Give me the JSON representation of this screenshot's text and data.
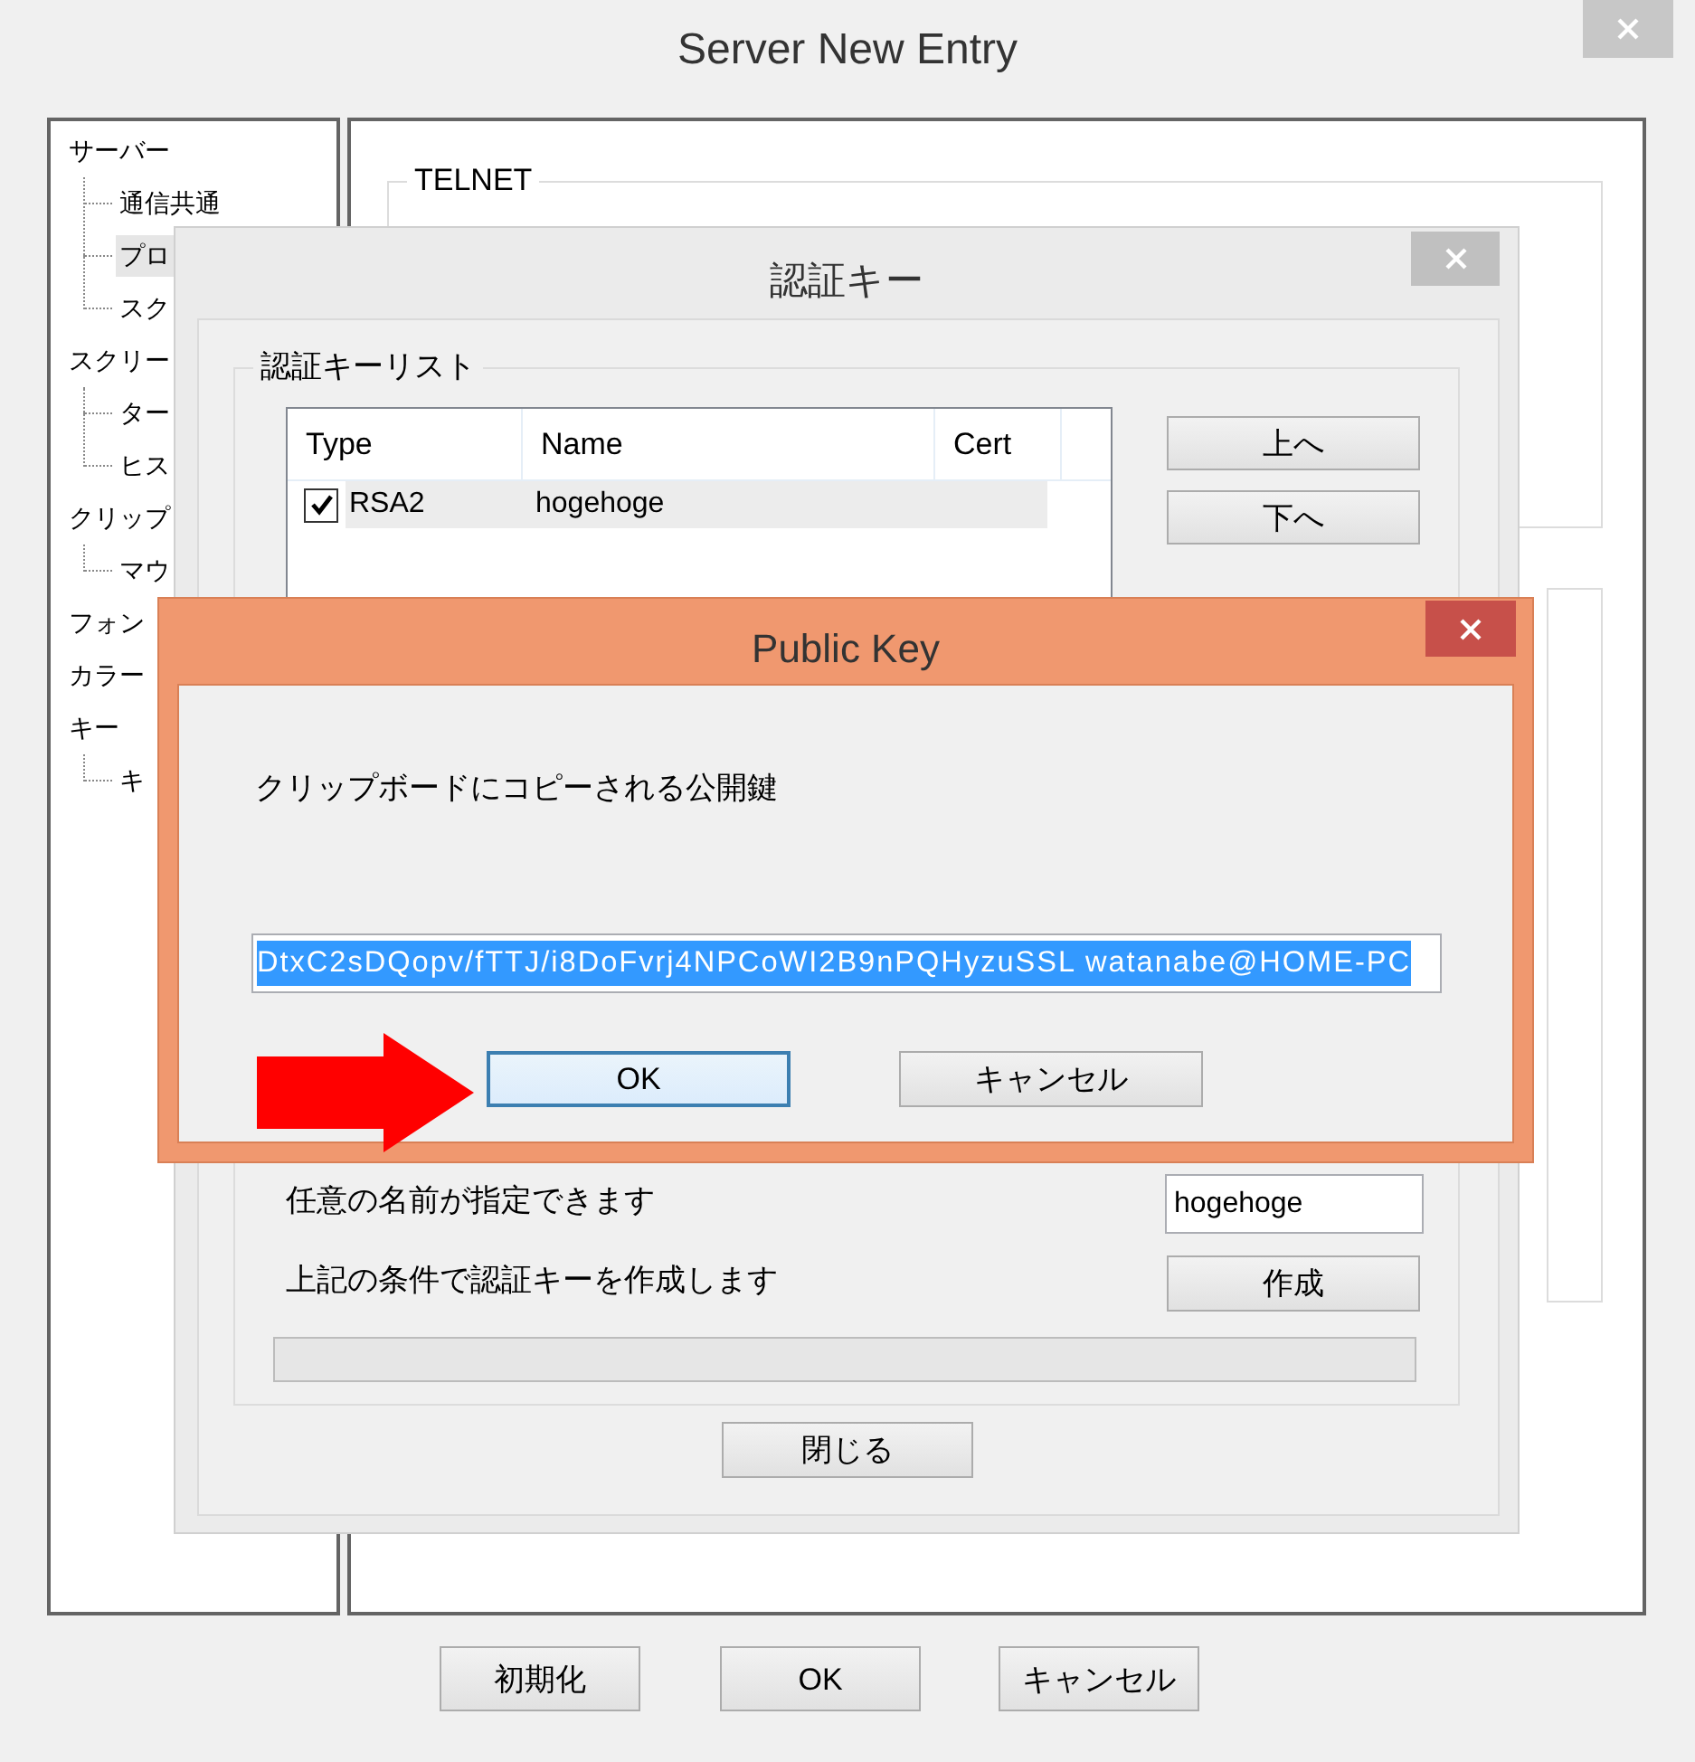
{
  "main_window": {
    "title": "Server New Entry",
    "tree": [
      {
        "label": "サーバー",
        "selected": false,
        "children": [
          {
            "label": "通信共通",
            "selected": false
          },
          {
            "label": "プロ",
            "selected": true
          },
          {
            "label": "スク",
            "selected": false
          }
        ]
      },
      {
        "label": "スクリー",
        "selected": false,
        "children": [
          {
            "label": "ター",
            "selected": false
          },
          {
            "label": "ヒス",
            "selected": false
          }
        ]
      },
      {
        "label": "クリップ",
        "selected": false,
        "children": [
          {
            "label": "マウ",
            "selected": false
          }
        ]
      },
      {
        "label": "フォン",
        "selected": false
      },
      {
        "label": "カラー",
        "selected": false
      },
      {
        "label": "キー",
        "selected": false,
        "children": [
          {
            "label": "キ",
            "selected": false
          }
        ]
      }
    ],
    "telnet_group": {
      "title": "TELNET"
    },
    "buttons": [
      "初期化",
      "OK",
      "キャンセル"
    ]
  },
  "auth_dialog": {
    "title": "認証キー",
    "list_group": {
      "title": "認証キーリスト"
    },
    "columns": [
      "Type",
      "Name",
      "Cert"
    ],
    "rows": [
      {
        "checked": true,
        "type": "RSA2",
        "name": "hogehoge"
      }
    ],
    "side_buttons": [
      "上へ",
      "下へ"
    ],
    "name_label": "任意の名前が指定できます",
    "name_value": "hogehoge",
    "create_label": "上記の条件で認証キーを作成します",
    "create_button": "作成",
    "progress": {
      "level": 0
    },
    "close_button": "閉じる"
  },
  "public_key_dialog": {
    "title": "Public Key",
    "message": "クリップボードにコピーされる公開鍵",
    "key_value": "DtxC2sDQopv/fTTJ/i8DoFvrj4NPCoWI2B9nPQHyzuSSL watanabe@HOME-PC",
    "buttons": [
      {
        "label": "OK",
        "focused": true
      },
      {
        "label": "キャンセル",
        "focused": false
      }
    ]
  }
}
